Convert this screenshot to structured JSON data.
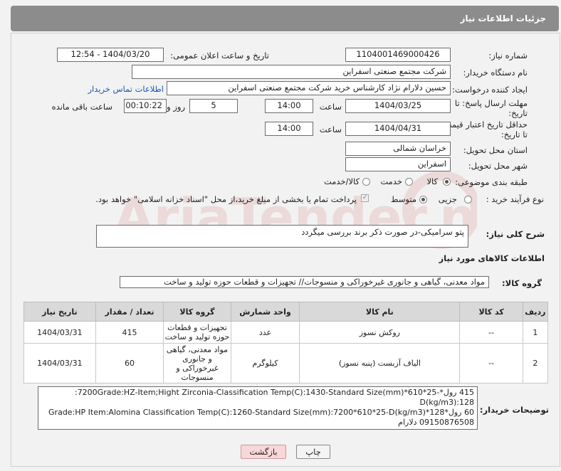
{
  "header": {
    "title": "جزئیات اطلاعات نیاز"
  },
  "form": {
    "need_number_label": "شماره نیاز:",
    "need_number": "1104001469000426",
    "announce_label": "تاریخ و ساعت اعلان عمومی:",
    "announce_value": "1404/03/20 - 12:54",
    "buyer_org_label": "نام دستگاه خریدار:",
    "buyer_org": "شرکت مجتمع صنعتی اسفراین",
    "creator_label": "ایجاد کننده درخواست:",
    "creator": "حسین دلارام نژاد کارشناس خرید شرکت مجتمع صنعتی اسفراین",
    "contact_link": "اطلاعات تماس خریدار",
    "deadline_label_1": "مهلت ارسال پاسخ: تا",
    "deadline_label_2": "تاریخ:",
    "deadline_date": "1404/03/25",
    "time_label": "ساعت",
    "deadline_time": "14:00",
    "days_value": "5",
    "days_label": "روز و",
    "remaining_value": "00:10:22",
    "remaining_label": "ساعت باقی مانده",
    "validity_label_1": "حداقل تاریخ اعتبار قیمت:",
    "validity_label_2": "تا تاریخ:",
    "validity_date": "1404/04/31",
    "validity_time": "14:00",
    "province_label": "استان محل تحویل:",
    "province": "خراسان شمالی",
    "city_label": "شهر محل تحویل:",
    "city": "اسفراین",
    "category_label": "طبقه بندی موضوعی:",
    "category_options": [
      "کالا",
      "خدمت",
      "کالا/خدمت"
    ],
    "category_selected": "کالا",
    "process_label": "نوع فرآیند خرید :",
    "process_options": [
      "جزیی",
      "متوسط"
    ],
    "process_selected": "متوسط",
    "payment_note": "پرداخت تمام یا بخشی از مبلغ خرید،از محل \"اسناد خزانه اسلامی\" خواهد بود."
  },
  "description": {
    "label": "شرح کلی نیاز:",
    "text": "پتو سرامیکی-در صورت ذکر برند بررسی میگردد"
  },
  "goods": {
    "section_title": "اطلاعات کالاهای مورد نیاز",
    "group_label": "گروه کالا:",
    "group_value": "مواد معدنی، گیاهی و جانوری غیرخوراکی و منسوجات// تجهیزات و قطعات حوزه تولید و ساخت",
    "columns": [
      "ردیف",
      "کد کالا",
      "نام کالا",
      "واحد شمارش",
      "گروه کالا",
      "تعداد / مقدار",
      "تاریخ نیاز"
    ],
    "rows": [
      {
        "row": "1",
        "code": "--",
        "name": "روکش نسوز",
        "unit": "عدد",
        "group": "تجهیزات و قطعات حوزه تولید و ساخت",
        "qty": "415",
        "date": "1404/03/31"
      },
      {
        "row": "2",
        "code": "--",
        "name": "الیاف آزبست (پنبه نسوز)",
        "unit": "کیلوگرم",
        "group": "مواد معدنی، گیاهی و جانوری غیرخوراکی و منسوجات",
        "qty": "60",
        "date": "1404/03/31"
      }
    ]
  },
  "buyer_notes": {
    "label": "توضیحات خریدار:",
    "line1": "415 رول*-25*610*7200Grade:HZ-Item;Hight Zirconia-Classification Temp(C):1430-Standard Size(mm):",
    "line2": "D(kg/m3):128",
    "line3": "60 رول*128*Grade:HP   Item:Alomina   Classification Temp(C):1260-Standard Size(mm):7200*610*25-D(kg/m3)",
    "line4": "09150876508 دلارام"
  },
  "buttons": {
    "print": "چاپ",
    "back": "بازگشت"
  },
  "watermark": {
    "text": "AriaTender.net"
  },
  "colors": {
    "title_bar": "#8c8c8c",
    "link": "#1a56b8",
    "back_button": "#f7d7d7",
    "watermark": "#c0392b"
  }
}
